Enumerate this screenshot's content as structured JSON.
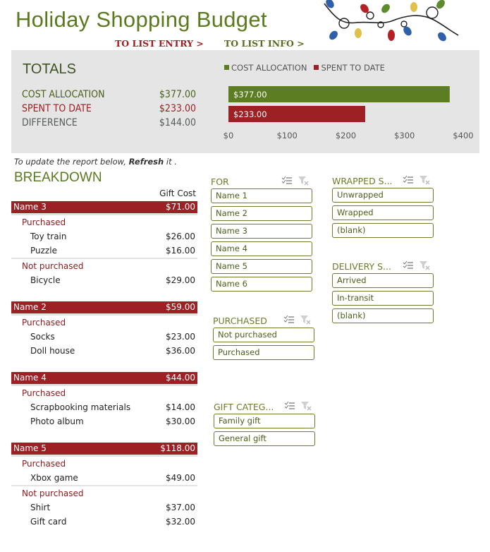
{
  "header": {
    "title": "Holiday Shopping Budget",
    "nav_list_entry": "TO LIST ENTRY >",
    "nav_list_info": "TO LIST INFO >"
  },
  "totals": {
    "heading": "TOTALS",
    "rows": [
      {
        "label": "COST ALLOCATION",
        "value": "$377.00"
      },
      {
        "label": "SPENT TO DATE",
        "value": "$233.00"
      },
      {
        "label": "DIFFERENCE",
        "value": "$144.00"
      }
    ]
  },
  "colors": {
    "green": "#5c7d22",
    "red": "#9c2024",
    "panel": "#e4e5e4"
  },
  "chart_data": {
    "type": "bar",
    "orientation": "horizontal",
    "title": "",
    "legend": [
      "COST ALLOCATION",
      "SPENT TO DATE"
    ],
    "legend_position": "top",
    "series": [
      {
        "name": "COST ALLOCATION",
        "value": 377,
        "label": "$377.00",
        "color": "#5c7d22"
      },
      {
        "name": "SPENT TO DATE",
        "value": 233,
        "label": "$233.00",
        "color": "#9c2024"
      }
    ],
    "x_ticks": [
      "$0",
      "$100",
      "$200",
      "$300",
      "$400"
    ],
    "xlim": [
      0,
      400
    ],
    "grid": false
  },
  "report": {
    "note_prefix": "To update the report below, ",
    "note_action": "Refresh",
    "note_suffix": " it .",
    "heading": "BREAKDOWN",
    "column_header": "Gift Cost",
    "groups": [
      {
        "name": "Name 3",
        "total": "$71.00",
        "statuses": [
          {
            "status": "Purchased",
            "items": [
              {
                "item": "Toy train",
                "cost": "$26.00"
              },
              {
                "item": "Puzzle",
                "cost": "$16.00"
              }
            ]
          },
          {
            "status": "Not purchased",
            "items": [
              {
                "item": "Bicycle",
                "cost": "$29.00"
              }
            ]
          }
        ]
      },
      {
        "name": "Name 2",
        "total": "$59.00",
        "statuses": [
          {
            "status": "Purchased",
            "items": [
              {
                "item": "Socks",
                "cost": "$23.00"
              },
              {
                "item": "Doll house",
                "cost": "$36.00"
              }
            ]
          }
        ]
      },
      {
        "name": "Name 4",
        "total": "$44.00",
        "statuses": [
          {
            "status": "Purchased",
            "items": [
              {
                "item": "Scrapbooking materials",
                "cost": "$14.00"
              },
              {
                "item": "Photo album",
                "cost": "$30.00"
              }
            ]
          }
        ]
      },
      {
        "name": "Name 5",
        "total": "$118.00",
        "statuses": [
          {
            "status": "Purchased",
            "items": [
              {
                "item": "Xbox game",
                "cost": "$49.00"
              }
            ]
          },
          {
            "status": "Not purchased",
            "items": [
              {
                "item": "Shirt",
                "cost": "$37.00"
              },
              {
                "item": "Gift card",
                "cost": "$32.00"
              }
            ]
          }
        ]
      }
    ]
  },
  "slicers": {
    "for": {
      "title": "FOR",
      "items": [
        "Name 1",
        "Name 2",
        "Name 3",
        "Name 4",
        "Name 5",
        "Name 6"
      ]
    },
    "purchased": {
      "title": "PURCHASED",
      "items": [
        "Not purchased",
        "Purchased"
      ]
    },
    "gift_category": {
      "title": "GIFT CATEG...",
      "items": [
        "Family gift",
        "General gift"
      ]
    },
    "wrapped": {
      "title": "WRAPPED S...",
      "items": [
        "Unwrapped",
        "Wrapped",
        "(blank)"
      ]
    },
    "delivery": {
      "title": "DELIVERY S...",
      "items": [
        "Arrived",
        "In-transit",
        "(blank)"
      ]
    }
  }
}
